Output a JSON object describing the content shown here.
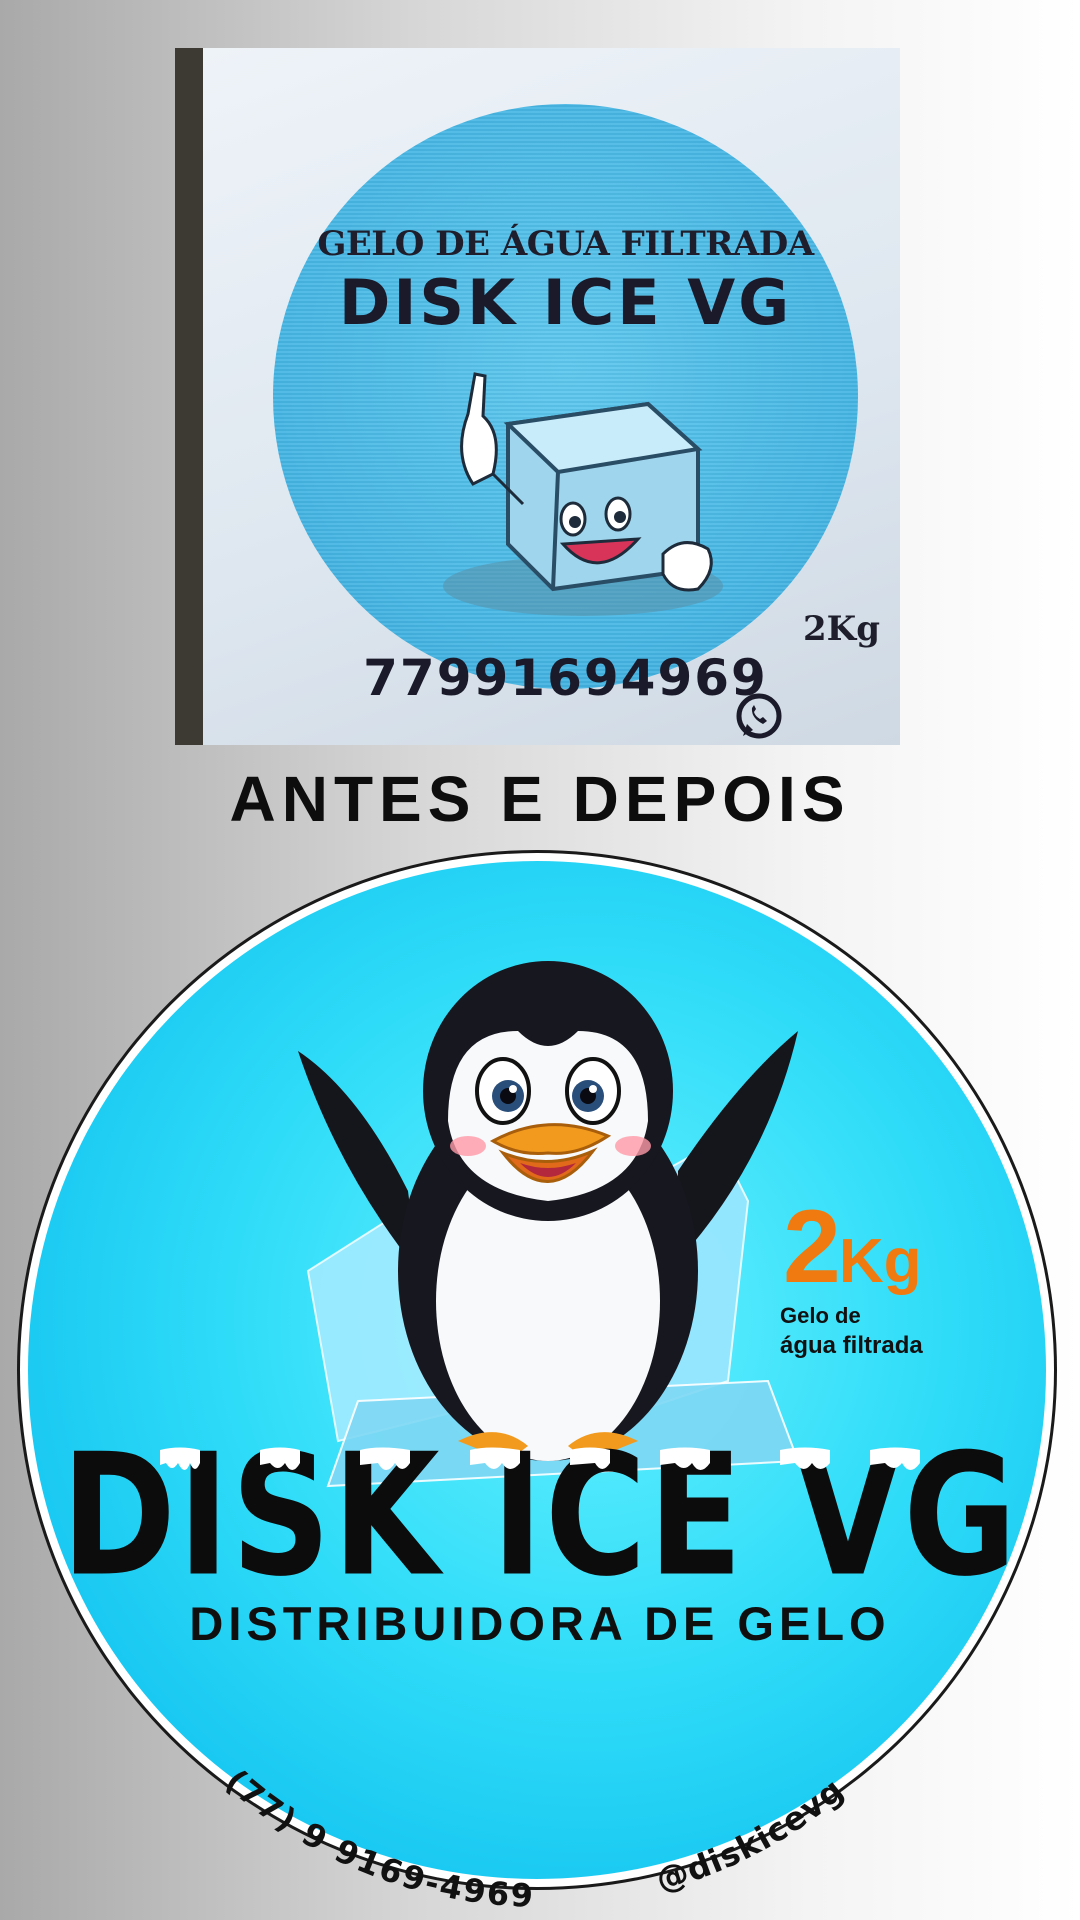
{
  "before": {
    "top_line": "GELO DE ÁGUA FILTRADA",
    "brand": "DISK ICE VG",
    "weight": "2Kg",
    "phone": "77991694969"
  },
  "heading": "ANTES E DEPOIS",
  "after": {
    "weight_number": "2",
    "weight_unit": "Kg",
    "gelo_line1": "Gelo de",
    "gelo_line2": "água filtrada",
    "brand": "DISK ICE VG",
    "tagline": "DISTRIBUIDORA DE GELO",
    "phone": "(77) 9 9169-4969",
    "handle": "@diskicevg"
  },
  "colors": {
    "old_label_blue": "#46b6e4",
    "new_label_cyan": "#2fdcf8",
    "accent_orange": "#f07a10"
  }
}
